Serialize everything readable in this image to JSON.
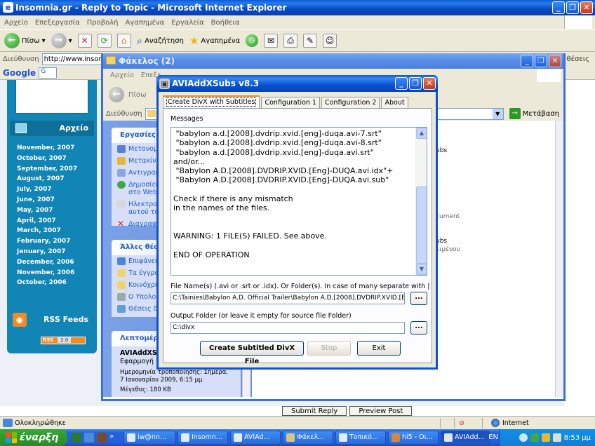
{
  "ie": {
    "title": "Insomnia.gr - Reply to Topic - Microsoft Internet Explorer",
    "menu": [
      "Αρχείο",
      "Επεξεργασία",
      "Προβολή",
      "Αγαπημένα",
      "Εργαλεία",
      "Βοήθεια"
    ],
    "back_label": "Πίσω",
    "search_label": "Αναζήτηση",
    "favorites_label": "Αγαπημένα",
    "address_label": "Διεύθυνση",
    "address_value": "http://www.insomn",
    "google_label": "Google",
    "google_box": "G",
    "right_edge_text": "θέσεις"
  },
  "blog": {
    "archive_title": "Αρχείο",
    "months": [
      "November, 2007",
      "October, 2007",
      "September, 2007",
      "August, 2007",
      "July, 2007",
      "June, 2007",
      "May, 2007",
      "April, 2007",
      "March, 2007",
      "February, 2007",
      "January, 2007",
      "December, 2006",
      "November, 2006",
      "October, 2006"
    ],
    "rss_title": "RSS Feeds",
    "rss_badge_left": "RSS",
    "rss_badge_right": "2.0"
  },
  "folder": {
    "title": "Φάκελος (2)",
    "menu": [
      "Αρχείο",
      "Επεξε"
    ],
    "back_label": "Πίσω",
    "address_label": "Διεύθυνση",
    "address_value": "C",
    "go_label": "Μετάβαση",
    "tasks_title": "Εργασίες αρ",
    "tasks": [
      "Μετονομ",
      "Μετακίνη",
      "Αντιγραφ",
      "Δημοσίευ\nστο Web",
      "Ηλεκτρον\nαυτού το",
      "Διαγραφή"
    ],
    "places_title": "Άλλες θέσει",
    "places": [
      "Επιφάνει",
      "Τα έγγρα",
      "Κοινόχρη",
      "Ο Υπολο",
      "Θέσεις δι"
    ],
    "details_title": "Λεπτομέρει",
    "details_name": "AVIAddXSub",
    "details_type": "Εφαρμογή",
    "details_modified": "Ημερομηνία τροποποίησης: Σήμερα, 7 Ιανουαρίου 2009, 6:15 μμ",
    "details_size": "Μέγεθος: 180 KB",
    "right_texts": [
      "ubs",
      "cument",
      "ubs",
      "κιμένου"
    ]
  },
  "dialog": {
    "title": "AVIAddXSubs v8.3",
    "tabs": [
      "Create DivX with Subtitles",
      "Configuration 1",
      "Configuration 2",
      "About"
    ],
    "messages_label": "Messages",
    "messages": [
      " \"babylon a.d.[2008].dvdrip.xvid.[eng]-duqa.avi-7.srt\"",
      " \"babylon a.d.[2008].dvdrip.xvid.[eng]-duqa.avi-8.srt\"",
      " \"babylon a.d.[2008].dvdrip.xvid.[eng]-duqa.avi.srt\"",
      "and/or...",
      " \"Babylon A.D.[2008].DVDRIP.XVID.[Eng]-DUQA.avi.idx\"+",
      " \"Babylon A.D.[2008].DVDRIP.XVID.[Eng]-DUQA.avi.sub\"",
      "",
      "Check if there is any mismatch",
      "in the names of the files.",
      "",
      "",
      "WARNING: 1 FILE(S) FAILED. See above.",
      "",
      "END OF OPERATION"
    ],
    "file_label": "File Name(s) (.avi or .srt or .idx). Or Folder(s). In case of many separate with |",
    "file_value": "C:\\Tainies\\Babylon A.D. Official Trailer\\Babylon A.D.[2008].DVDRIP.XVID.[Eng]-DL",
    "browse_label": "...",
    "output_label": "Output Folder (or leave it empty for source file Folder)",
    "output_value": "C:\\divx",
    "create_button": "Create Subtitled DivX File",
    "stop_button": "Stop",
    "exit_button": "Exit"
  },
  "page_buttons": [
    "Submit Reply",
    "Preview Post"
  ],
  "status": {
    "left": "Ολοκληρώθηκε",
    "zone": "Internet"
  },
  "taskbar": {
    "start_label": "έναρξη",
    "items": [
      "iw@nn...",
      "Insomn...",
      "AVIAd...",
      "Φάκελ...",
      "Τοπικό...",
      "hi5 - Οι...",
      "AVIAdd..."
    ],
    "lang": "EN",
    "clock": "8:53 μμ"
  },
  "colors": {
    "xp_blue": "#0a5ad8",
    "blog_teal": "#1185b5",
    "tasks_blue": "#7ba2e7",
    "dialog_face": "#ece9d8",
    "start_green": "#2e9d2e"
  }
}
